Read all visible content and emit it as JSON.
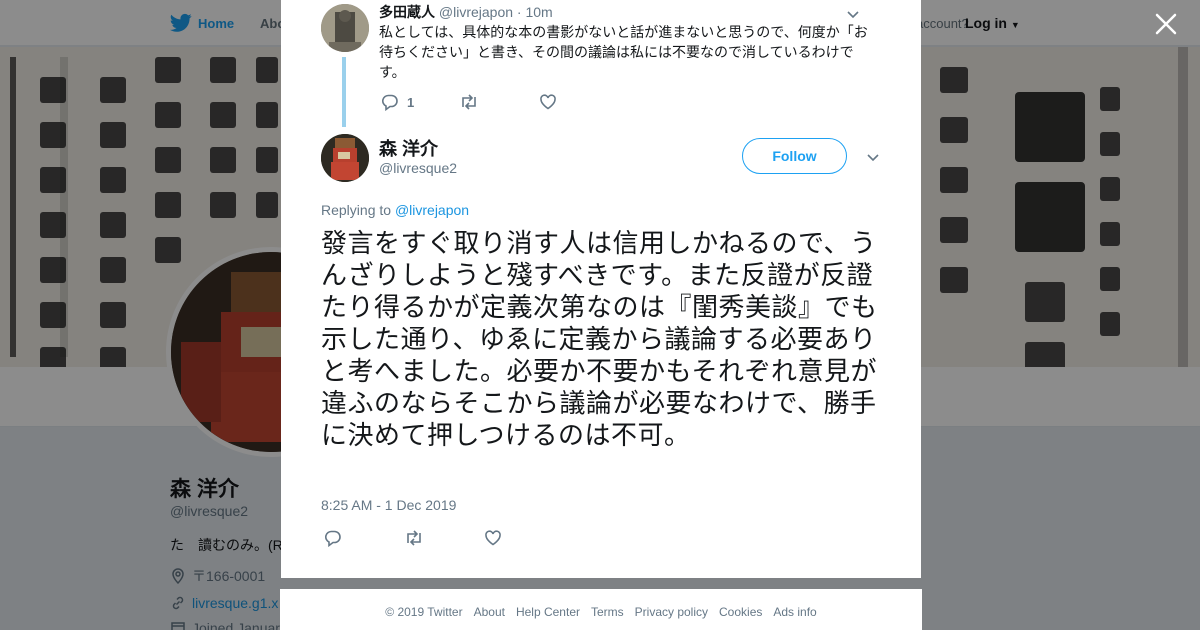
{
  "topnav": {
    "home_label": "Home",
    "about_label": "Abo",
    "account_question": "account?",
    "login_label": "Log in"
  },
  "profile": {
    "name": "森 洋介",
    "handle": "@livresque2",
    "bio": "た　讀むのみ。(R",
    "location": "〒166-0001",
    "url": "livresque.g1.x",
    "joined": "Joined January"
  },
  "context_tweet": {
    "name": "多田蔵人",
    "handle": "@livrejapon",
    "time": "· 10m",
    "text": "私としては、具体的な本の書影がないと話が進まないと思うので、何度か「お待ちください」と書き、その間の議論は私には不要なので消しているわけです。",
    "reply_count": "1"
  },
  "main_tweet": {
    "name": "森 洋介",
    "handle": "@livresque2",
    "follow_label": "Follow",
    "replying_prefix": "Replying to",
    "replying_to": "@livrejapon",
    "text": "發言をすぐ取り消す人は信用しかねるので、うんざりしようと殘すべきです。また反證が反證たり得るかが定義次第なのは『閨秀美談』でも示した通り、ゆゑに定義から議論する必要ありと考へました。必要か不要かもそれぞれ意見が違ふのならそこから議論が必要なわけで、勝手に決めて押しつけるのは不可。",
    "timestamp": "8:25 AM - 1 Dec 2019"
  },
  "footer": {
    "links": [
      "© 2019 Twitter",
      "About",
      "Help Center",
      "Terms",
      "Privacy policy",
      "Cookies",
      "Ads info"
    ]
  },
  "icons": {
    "close": "close-icon",
    "reply": "reply-icon",
    "retweet": "retweet-icon",
    "like": "heart-icon",
    "caret": "chevron-down-icon",
    "bird": "twitter-bird-icon"
  },
  "colors": {
    "accent": "#1da1f2",
    "link": "#1b95e0",
    "muted": "#657786",
    "thread": "#9ad0ec"
  }
}
